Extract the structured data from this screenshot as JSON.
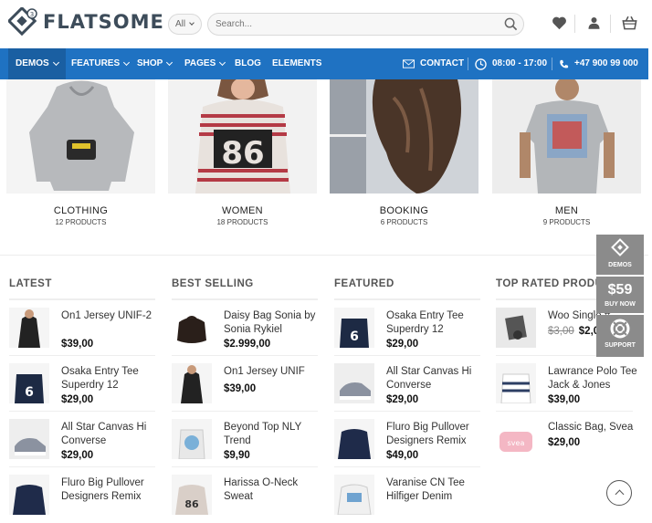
{
  "brand": {
    "name": "FLATSOME",
    "badge": "3"
  },
  "search": {
    "category": "All",
    "placeholder": "Search..."
  },
  "nav": {
    "items": [
      {
        "label": "DEMOS",
        "dropdown": true
      },
      {
        "label": "FEATURES",
        "dropdown": true
      },
      {
        "label": "SHOP",
        "dropdown": true
      },
      {
        "label": "PAGES",
        "dropdown": true
      },
      {
        "label": "BLOG",
        "dropdown": false
      },
      {
        "label": "ELEMENTS",
        "dropdown": false
      }
    ],
    "contact": "CONTACT",
    "hours": "08:00 - 17:00",
    "phone": "+47 900 99 000"
  },
  "categories": [
    {
      "title": "CLOTHING",
      "count": "12 PRODUCTS"
    },
    {
      "title": "WOMEN",
      "count": "18 PRODUCTS"
    },
    {
      "title": "BOOKING",
      "count": "6 PRODUCTS"
    },
    {
      "title": "MEN",
      "count": "9 PRODUCTS"
    }
  ],
  "columns": [
    {
      "title": "LATEST",
      "products": [
        {
          "name": "On1 Jersey UNIF-2",
          "price": "$39,00"
        },
        {
          "name": "Osaka Entry Tee Superdry 12",
          "price": "$29,00"
        },
        {
          "name": "All Star Canvas Hi Converse",
          "price": "$29,00"
        },
        {
          "name": "Fluro Big Pullover Designers Remix",
          "price": ""
        }
      ]
    },
    {
      "title": "BEST SELLING",
      "products": [
        {
          "name": "Daisy Bag Sonia by Sonia Rykiel",
          "price": "$2.999,00"
        },
        {
          "name": "On1 Jersey UNIF",
          "price": "$39,00"
        },
        {
          "name": "Beyond Top NLY Trend",
          "price": "$9,90"
        },
        {
          "name": "Harissa O-Neck Sweat",
          "price": ""
        }
      ]
    },
    {
      "title": "FEATURED",
      "products": [
        {
          "name": "Osaka Entry Tee Superdry 12",
          "price": "$29,00"
        },
        {
          "name": "All Star Canvas Hi Converse",
          "price": "$29,00"
        },
        {
          "name": "Fluro Big Pullover Designers Remix",
          "price": "$49,00"
        },
        {
          "name": "Varanise CN Tee Hilfiger Denim",
          "price": ""
        }
      ]
    },
    {
      "title": "TOP RATED PRODUCTS",
      "products": [
        {
          "name": "Woo Single #",
          "old_price": "$3,00",
          "price": "$2,00"
        },
        {
          "name": "Lawrance Polo Tee Jack & Jones",
          "price": "$39,00"
        },
        {
          "name": "Classic Bag, Svea",
          "price": "$29,00"
        }
      ]
    }
  ],
  "side_panel": {
    "demos": "DEMOS",
    "price": "$59",
    "buy": "BUY NOW",
    "support": "SUPPORT"
  },
  "colors": {
    "nav": "#1f72c2",
    "nav_active": "#1a5fa2",
    "panel": "#8b8b8b"
  }
}
